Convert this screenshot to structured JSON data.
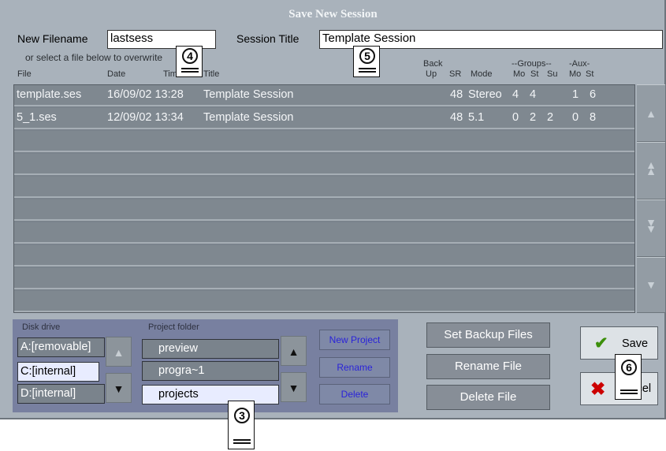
{
  "dialog": {
    "title": "Save New Session"
  },
  "filename": {
    "label": "New Filename",
    "value": "lastsess"
  },
  "session_title": {
    "label": "Session Title",
    "value": "Template Session"
  },
  "hint": "or select a file below to overwrite",
  "columns": {
    "file": "File",
    "date": "Date",
    "time": "Time",
    "title": "Title",
    "back_top": "Back",
    "back_bottom": "Up",
    "sr": "SR",
    "mode": "Mode",
    "groups_header": "--Groups--",
    "aux_header": "-Aux-",
    "g_mo": "Mo",
    "g_st": "St",
    "g_su": "Su",
    "a_mo": "Mo",
    "a_st": "St"
  },
  "files": [
    {
      "file": "template.ses",
      "datetime": "16/09/02 13:28",
      "title": "Template Session",
      "sr": "48",
      "mode": "Stereo",
      "g_mo": "4",
      "g_st": "4",
      "g_su": "",
      "a_mo": "1",
      "a_st": "6"
    },
    {
      "file": "5_1.ses",
      "datetime": "12/09/02 13:34",
      "title": "Template Session",
      "sr": "48",
      "mode": "5.1",
      "g_mo": "0",
      "g_st": "2",
      "g_su": "2",
      "a_mo": "0",
      "a_st": "8"
    }
  ],
  "scroll_icons": [
    "chevron-up-icon",
    "double-chevron-up-icon",
    "double-chevron-down-icon",
    "chevron-down-icon"
  ],
  "disk": {
    "label": "Disk drive",
    "items": [
      "A:[removable]",
      "C:[internal]",
      "D:[internal]"
    ],
    "selected": "C:[internal]"
  },
  "project": {
    "label": "Project folder",
    "items": [
      "preview",
      "progra~1",
      "projects"
    ],
    "selected": "projects"
  },
  "project_buttons": {
    "new": "New Project",
    "rename": "Rename",
    "delete": "Delete"
  },
  "file_buttons": {
    "backup": "Set Backup Files",
    "rename": "Rename File",
    "delete": "Delete File"
  },
  "save": {
    "label": "Save",
    "icon": "checkmark-icon"
  },
  "cancel": {
    "label": "Cancel",
    "icon": "x-icon"
  },
  "callouts": [
    "4",
    "5",
    "3",
    "6"
  ],
  "colors": {
    "panel": "#a9b2bb",
    "list_row": "#7f8890",
    "project_panel": "#7880a0",
    "selected_item": "#e8ecff",
    "link_text": "#2a23d9",
    "check": "#3c8f0b",
    "cross": "#cc0000"
  }
}
